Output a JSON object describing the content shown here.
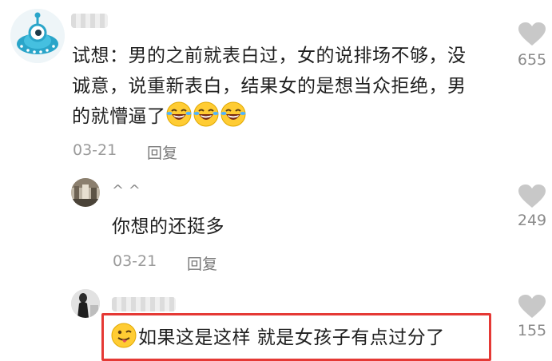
{
  "comment": {
    "username": "",
    "text_line1": "试想：男的之前就表白过，女的说排场不够，没",
    "text_line2": "诚意，说重新表白，结果女的是想当众拒绝，男",
    "text_line3": "的就懵逼了",
    "trailing_emojis": [
      "laughing-crying-emoji",
      "laughing-crying-emoji",
      "laughing-crying-emoji"
    ],
    "date": "03-21",
    "reply_label": "回复",
    "likes": "655"
  },
  "replies": [
    {
      "username": "^ ^",
      "text": "你想的还挺多",
      "date": "03-21",
      "reply_label": "回复",
      "likes": "249"
    },
    {
      "username": "",
      "text": "如果这是这样 就是女孩子有点过分了",
      "leading_emoji": "tongue-out-emoji",
      "likes": "155"
    }
  ],
  "colors": {
    "highlight_border": "#e53935",
    "heart": "#c8c8c8",
    "meta_text": "#9a9a9a"
  }
}
